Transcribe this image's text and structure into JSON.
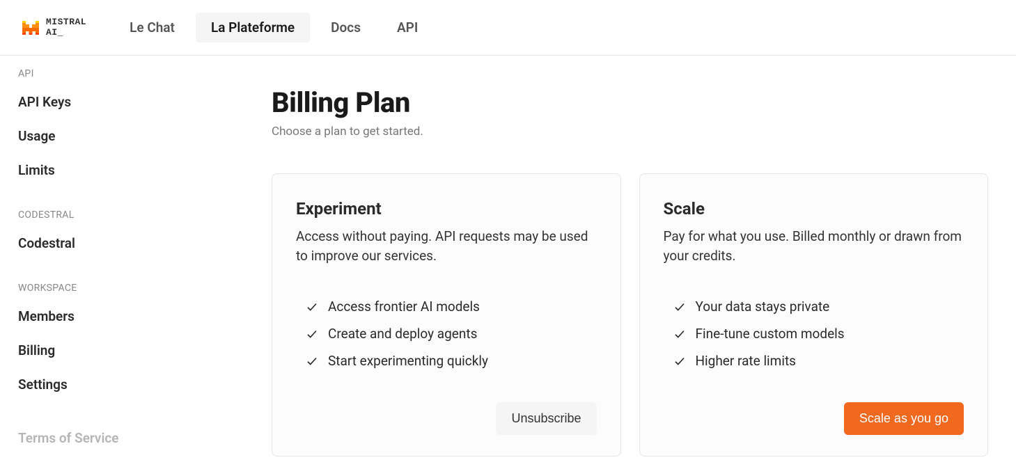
{
  "brand": {
    "line1": "MISTRAL",
    "line2": "AI_"
  },
  "nav": {
    "items": [
      {
        "label": "Le Chat",
        "active": false
      },
      {
        "label": "La Plateforme",
        "active": true
      },
      {
        "label": "Docs",
        "active": false
      },
      {
        "label": "API",
        "active": false
      }
    ]
  },
  "sidebar": {
    "groups": [
      {
        "label": "API",
        "items": [
          "API Keys",
          "Usage",
          "Limits"
        ]
      },
      {
        "label": "CODESTRAL",
        "items": [
          "Codestral"
        ]
      },
      {
        "label": "WORKSPACE",
        "items": [
          "Members",
          "Billing",
          "Settings"
        ]
      }
    ],
    "footer_item": "Terms of Service"
  },
  "page": {
    "title": "Billing Plan",
    "subtitle": "Choose a plan to get started."
  },
  "plans": [
    {
      "name": "Experiment",
      "description": "Access without paying. API requests may be used to improve our services.",
      "features": [
        "Access frontier AI models",
        "Create and deploy agents",
        "Start experimenting quickly"
      ],
      "button": {
        "label": "Unsubscribe",
        "style": "light"
      }
    },
    {
      "name": "Scale",
      "description": "Pay for what you use. Billed monthly or drawn from your credits.",
      "features": [
        "Your data stays private",
        "Fine-tune custom models",
        "Higher rate limits"
      ],
      "button": {
        "label": "Scale as you go",
        "style": "primary"
      }
    }
  ]
}
